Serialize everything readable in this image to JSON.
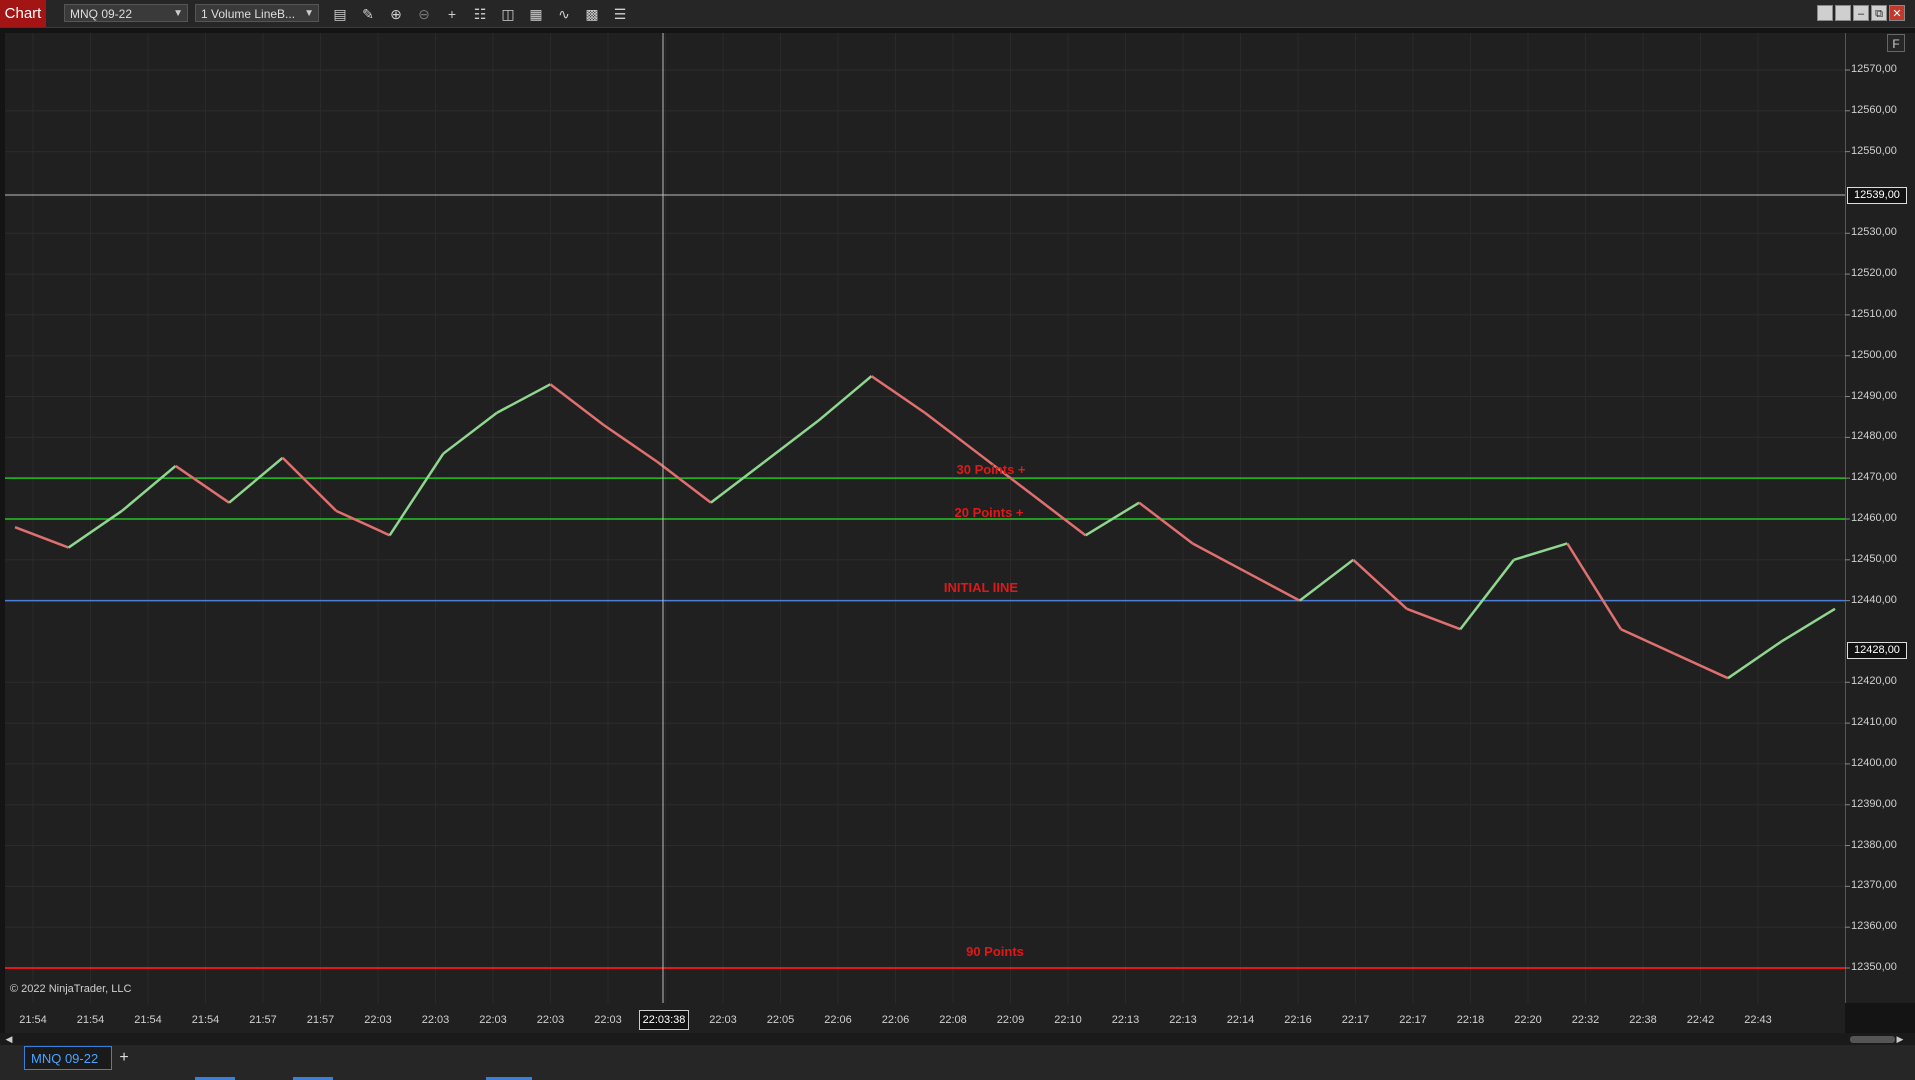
{
  "app_title": "Chart",
  "toolbar": {
    "instrument": "MNQ 09-22",
    "bar_type": "1 Volume LineB...",
    "icons": [
      "bar-style-icon",
      "draw-pencil-icon",
      "zoom-in-icon",
      "zoom-out-icon",
      "crosshair-icon",
      "properties-icon",
      "data-box-icon",
      "strategies-icon",
      "indicators-icon",
      "chart-trader-icon"
    ]
  },
  "window_buttons": [
    "tile-icon",
    "tile-icon",
    "minimize-icon",
    "restore-icon",
    "close-icon"
  ],
  "f_button": "F",
  "price_axis": {
    "labels": [
      "12570,00",
      "12560,00",
      "12550,00",
      "12530,00",
      "12520,00",
      "12510,00",
      "12500,00",
      "12490,00",
      "12480,00",
      "12470,00",
      "12460,00",
      "12450,00",
      "12440,00",
      "12420,00",
      "12410,00",
      "12400,00",
      "12390,00",
      "12380,00",
      "12370,00",
      "12360,00",
      "12350,00"
    ],
    "crosshair_price": "12539,00",
    "last_price": "12428,00"
  },
  "time_axis": {
    "labels": [
      "21:54",
      "21:54",
      "21:54",
      "21:54",
      "21:57",
      "21:57",
      "22:03",
      "22:03",
      "22:03",
      "22:03",
      "22:03",
      "22:03",
      "22:03",
      "22:05",
      "22:06",
      "22:06",
      "22:08",
      "22:09",
      "22:10",
      "22:13",
      "22:13",
      "22:14",
      "22:16",
      "22:17",
      "22:17",
      "22:18",
      "22:20",
      "22:32",
      "22:38",
      "22:42",
      "22:43"
    ],
    "crosshair_time": "22:03:38"
  },
  "lines": [
    {
      "label": "30 Points +",
      "price": 12470,
      "color": "#22c422"
    },
    {
      "label": "20 Points +",
      "price": 12460,
      "color": "#22c422"
    },
    {
      "label": "INITIAL lINE",
      "price": 12440,
      "color": "#4a7fd6"
    },
    {
      "label": "90 Points",
      "price": 12350,
      "color": "#e01818"
    }
  ],
  "copyright": "© 2022 NinjaTrader, LLC",
  "tab": {
    "label": "MNQ 09-22",
    "add": "+"
  },
  "colors": {
    "up": "#8fd68f",
    "down": "#e07070",
    "background": "#202020"
  },
  "chart_data": {
    "type": "line",
    "title": "MNQ 09-22",
    "ylim": [
      12345,
      12579
    ],
    "x": [
      "21:54",
      "21:54",
      "21:54",
      "21:54",
      "21:57",
      "21:57",
      "22:03",
      "22:03",
      "22:03",
      "22:03",
      "22:03",
      "22:03",
      "22:03",
      "22:05",
      "22:06",
      "22:06",
      "22:08",
      "22:09",
      "22:10",
      "22:13",
      "22:13",
      "22:14",
      "22:16",
      "22:17",
      "22:17",
      "22:18",
      "22:20",
      "22:32",
      "22:38",
      "22:42",
      "22:43"
    ],
    "series": [
      {
        "values": [
          12458,
          12453,
          12462,
          12473,
          12464,
          12475,
          12462,
          12456,
          12476,
          12486,
          12493,
          12483,
          12474,
          12464,
          12474,
          12484,
          12495,
          12486,
          12476,
          12466,
          12456,
          12464,
          12454,
          12447,
          12440,
          12450,
          12438,
          12433,
          12450,
          12454,
          12433,
          12427,
          12421,
          12430,
          12438
        ]
      }
    ]
  }
}
